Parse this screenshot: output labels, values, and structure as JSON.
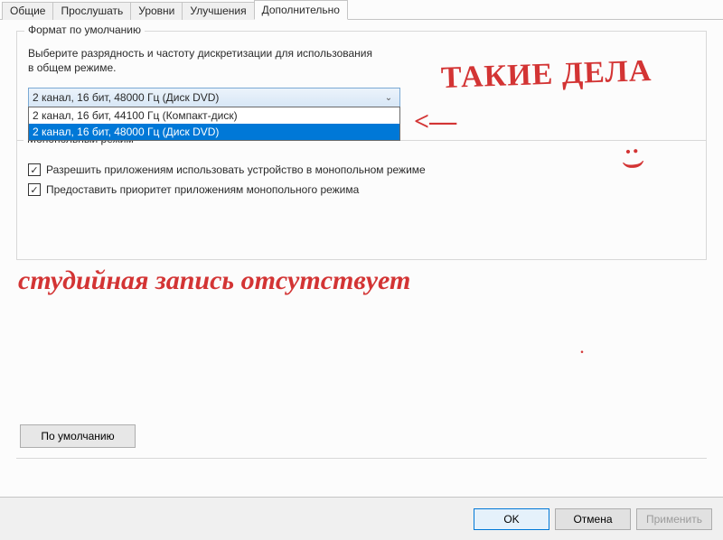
{
  "tabs": {
    "general": "Общие",
    "listen": "Прослушать",
    "levels": "Уровни",
    "enhance": "Улучшения",
    "advanced": "Дополнительно"
  },
  "defaultFormat": {
    "title": "Формат по умолчанию",
    "desc1": "Выберите разрядность и частоту дискретизации для использования",
    "desc2": "в общем режиме.",
    "selected": "2 канал, 16 бит, 48000 Гц (Диск DVD)",
    "option1": "2 канал, 16 бит, 44100 Гц (Компакт-диск)",
    "option2": "2 канал, 16 бит, 48000 Гц (Диск DVD)"
  },
  "exclusive": {
    "title": "Монопольный режим",
    "opt1": "Разрешить приложениям использовать устройство в монопольном режиме",
    "opt2": "Предоставить приоритет приложениям монопольного режима",
    "checkmark": "✓"
  },
  "buttons": {
    "default": "По умолчанию",
    "ok": "OK",
    "cancel": "Отмена",
    "apply": "Применить"
  },
  "handwriting": {
    "top": "ТАКИЕ ДЕЛА",
    "arrow": "<—",
    "smile": ": )",
    "bottom": "студийная запись отсутствует",
    "dot": "."
  }
}
